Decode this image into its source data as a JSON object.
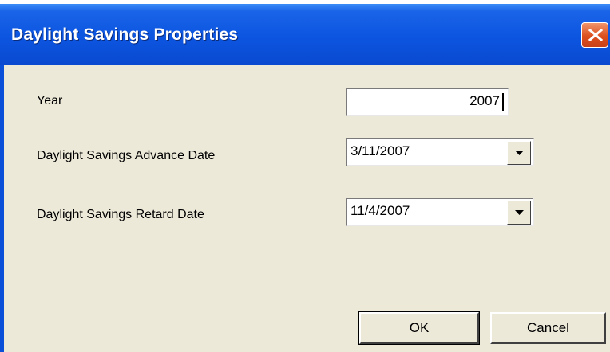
{
  "window": {
    "title": "Daylight Savings Properties",
    "close_icon": "close-x-icon"
  },
  "form": {
    "year_label": "Year",
    "year_value": "2007",
    "advance_label": "Daylight Savings Advance Date",
    "advance_value": "3/11/2007",
    "retard_label": "Daylight Savings Retard Date",
    "retard_value": "11/4/2007",
    "dropdown_icon": "chevron-down-icon"
  },
  "buttons": {
    "ok_label": "OK",
    "cancel_label": "Cancel"
  },
  "colors": {
    "titlebar": "#0a55e0",
    "client_background": "#ece9d8",
    "close_button": "#dc4f1e"
  }
}
